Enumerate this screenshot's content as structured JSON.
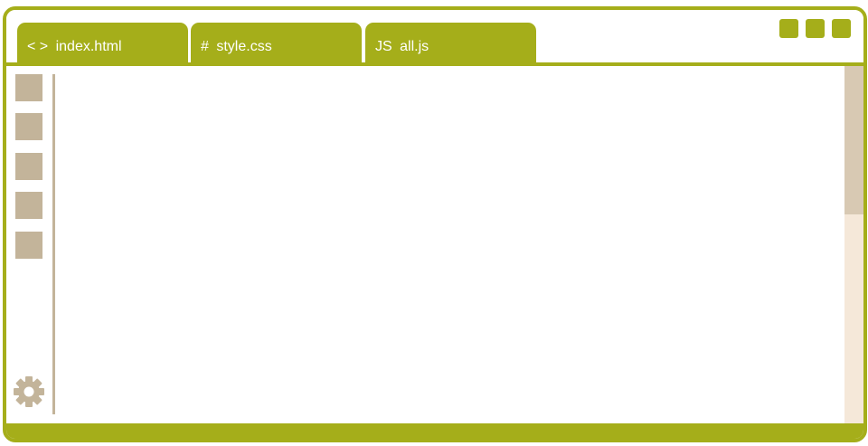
{
  "tabs": [
    {
      "icon": "< >",
      "label": "index.html"
    },
    {
      "icon": "#",
      "label": "style.css"
    },
    {
      "icon": "JS",
      "label": "all.js"
    }
  ],
  "colors": {
    "accent": "#a5ae1a",
    "sidebar_button": "#c3b49a",
    "scroll_track": "#f5e8d9",
    "scroll_thumb": "#d8c9b3"
  },
  "icons": {
    "settings": "gear-icon"
  }
}
